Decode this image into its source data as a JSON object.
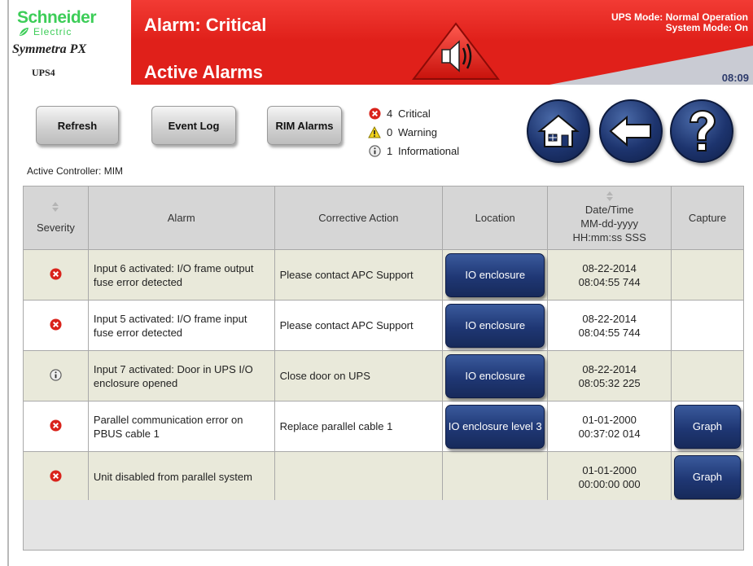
{
  "brand": {
    "company": "Schneider",
    "company_sub": "Electric",
    "product": "Symmetra PX",
    "unit": "UPS4"
  },
  "header": {
    "alarm_state": "Alarm: Critical",
    "page_title": "Active Alarms",
    "ups_mode": "UPS Mode: Normal Operation",
    "system_mode": "System Mode: On",
    "clock": "08:09",
    "colors": {
      "band": "#e0201a",
      "accent": "#2d3b6b"
    }
  },
  "toolbar": {
    "refresh_label": "Refresh",
    "event_log_label": "Event Log",
    "rim_alarms_label": "RIM Alarms"
  },
  "alarm_counts": [
    {
      "icon": "critical-icon",
      "count": "4",
      "label": "Critical"
    },
    {
      "icon": "warning-icon",
      "count": "0",
      "label": "Warning"
    },
    {
      "icon": "info-icon",
      "count": "1",
      "label": "Informational"
    }
  ],
  "nav": {
    "home": "home-icon",
    "back": "back-arrow-icon",
    "help": "help-icon"
  },
  "active_controller": "Active Controller: MIM",
  "table": {
    "headers": {
      "severity": "Severity",
      "alarm": "Alarm",
      "action": "Corrective Action",
      "location": "Location",
      "date_l1": "Date/Time",
      "date_l2": "MM-dd-yyyy",
      "date_l3": "HH:mm:ss SSS",
      "capture": "Capture"
    },
    "rows": [
      {
        "severity": "critical",
        "alarm": "Input 6 activated: I/O frame output fuse error detected",
        "action": "Please contact APC Support",
        "location": "IO enclosure",
        "date": "08-22-2014",
        "time": "08:04:55 744",
        "capture": ""
      },
      {
        "severity": "critical",
        "alarm": "Input 5 activated: I/O frame input fuse error detected",
        "action": "Please contact APC Support",
        "location": "IO enclosure",
        "date": "08-22-2014",
        "time": "08:04:55 744",
        "capture": ""
      },
      {
        "severity": "informational",
        "alarm": "Input 7 activated: Door in UPS I/O enclosure opened",
        "action": "Close door on UPS",
        "location": "IO enclosure",
        "date": "08-22-2014",
        "time": "08:05:32 225",
        "capture": ""
      },
      {
        "severity": "critical",
        "alarm": "Parallel communication error on PBUS cable 1",
        "action": "Replace parallel cable 1",
        "location": "IO enclosure level 3",
        "date": "01-01-2000",
        "time": "00:37:02 014",
        "capture": "Graph"
      },
      {
        "severity": "critical",
        "alarm": "Unit disabled from parallel system",
        "action": "",
        "location": "",
        "date": "01-01-2000",
        "time": "00:00:00 000",
        "capture": "Graph"
      }
    ]
  }
}
